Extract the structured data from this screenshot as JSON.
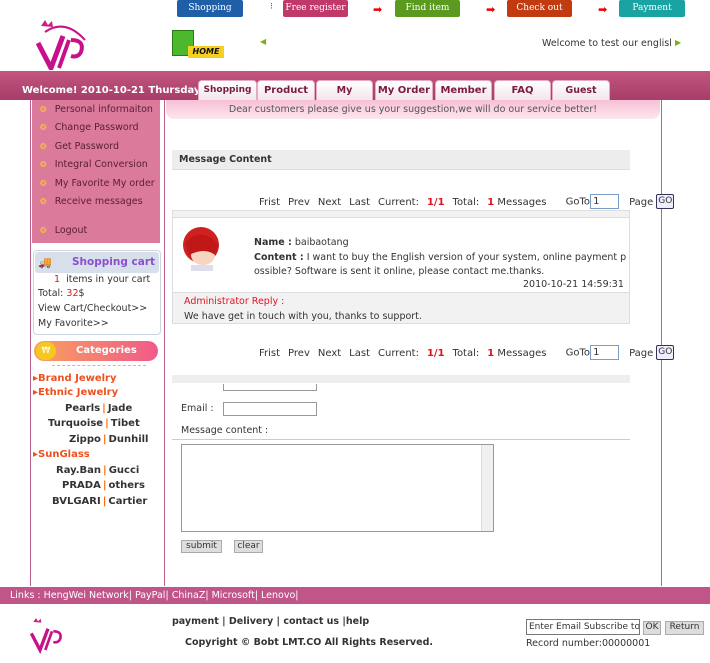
{
  "top_nav": [
    {
      "label": "Shopping guide",
      "color": "#1e5fa8"
    },
    {
      "label": "Free register",
      "color": "#c0396a"
    },
    {
      "label": "Find item",
      "color": "#5a9a1e"
    },
    {
      "label": "Check out",
      "color": "#c23a10"
    },
    {
      "label": "Payment",
      "color": "#1aa3a3"
    }
  ],
  "logo_text": "VIP",
  "home_label": "HOME",
  "marquee": "Welcome to test our englisl",
  "welcome": "Welcome! 2010-10-21 Thursday",
  "tabs": [
    "Shopping Cart",
    "Product",
    "My Favorite",
    "My Order",
    "Member",
    "FAQ",
    "Guest Book"
  ],
  "sidebar": {
    "menu": [
      "Personal informaiton",
      "Change Password",
      "Get Password",
      "Integral Conversion",
      "My Favorite  My order",
      "Receive messages",
      "Logout"
    ],
    "cart": {
      "title": "Shopping  cart",
      "count": "1",
      "count_text": "items in your cart",
      "total_label": "Total:",
      "total_value": "32",
      "total_unit": "$",
      "view": "View Cart/Checkout>>",
      "fav": "My Favorite>>"
    },
    "categories_title": "Categories",
    "categories": [
      {
        "label": "Brand Jewelry",
        "hot": true
      },
      {
        "label": "Ethnic Jewelry",
        "hot": true
      },
      {
        "pair": [
          "Pearls",
          "Jade"
        ]
      },
      {
        "pair": [
          "Turquoise",
          "Tibet"
        ]
      },
      {
        "pair": [
          "Zippo",
          "Dunhill"
        ]
      },
      {
        "label": "SunGlass",
        "hot": true
      },
      {
        "pair": [
          "Ray.Ban",
          "Gucci"
        ]
      },
      {
        "pair": [
          "PRADA",
          "others"
        ]
      },
      {
        "pair": [
          "BVLGARI",
          "Cartier"
        ]
      }
    ]
  },
  "notice": "Dear customers please give us your suggestion,we will do our service better!",
  "section_title": "Message Content",
  "pagination": {
    "first": "Frist",
    "prev": "Prev",
    "next": "Next",
    "last": "Last",
    "current_label": "Current:",
    "current": "1/1",
    "total_label": "Total:",
    "total": "1",
    "messages": "Messages",
    "goto": "GoTo",
    "page_value": "1",
    "page": "Page",
    "go": "GO"
  },
  "message": {
    "name_label": "Name :",
    "name": "baibaotang",
    "content_label": "Content :",
    "content": "I want to buy the English version of your system, online payment possible? Software is sent it online, please contact me.thanks.",
    "time": "2010-10-21 14:59:31",
    "reply_label": "Administrator Reply :",
    "reply": "We have get in touch with you, thanks to support."
  },
  "form": {
    "email_label": "Email :",
    "content_label": "Message content :",
    "submit": "submit",
    "clear": "clear"
  },
  "footer": {
    "links_label": "Links :",
    "links": [
      "HengWei Network",
      "PayPal",
      "ChinaZ",
      "Microsoft",
      "Lenovo"
    ],
    "nav": [
      "payment",
      "Delivery",
      "contact us",
      "help"
    ],
    "copyright": "Copyright © Bobt LMT.CO All Rights Reserved.",
    "subscribe_value": "Enter Email Subscribe to m",
    "ok": "OK",
    "return": "Return",
    "record": "Record number:00000001"
  }
}
